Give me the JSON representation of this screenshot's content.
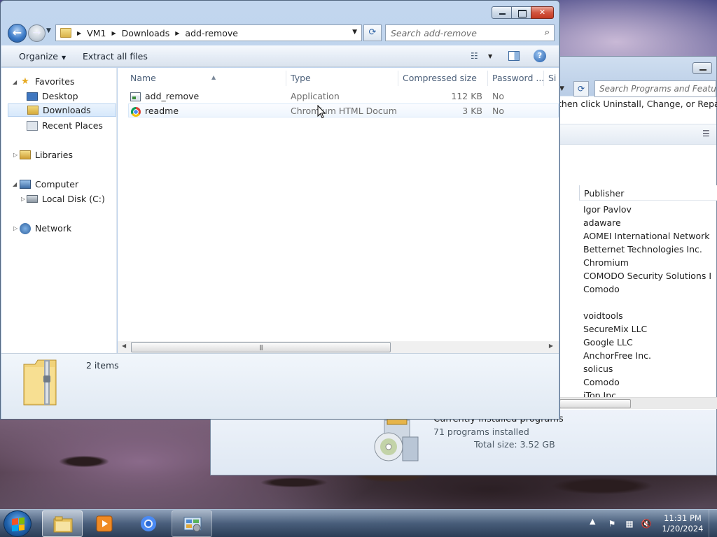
{
  "bg_window": {
    "search_placeholder": "Search Programs and Features",
    "description": "then click Uninstall, Change, or Repair.",
    "column_publisher": "Publisher",
    "publishers": [
      "Igor Pavlov",
      "adaware",
      "AOMEI International Network Li...",
      "Betternet Technologies Inc.",
      "Chromium",
      "COMODO Security Solutions Inc.",
      "Comodo",
      "",
      "voidtools",
      "SecureMix LLC",
      "Google LLC",
      "AnchorFree Inc.",
      "solicus",
      "Comodo",
      "iTop Inc."
    ],
    "details_title": "Currently installed programs",
    "details_count": "71 programs installed",
    "details_size": "Total size: 3.52 GB"
  },
  "explorer": {
    "breadcrumb": [
      "VM1",
      "Downloads",
      "add-remove"
    ],
    "search_placeholder": "Search add-remove",
    "toolbar": {
      "organize": "Organize",
      "extract": "Extract all files"
    },
    "nav": {
      "favorites": "Favorites",
      "desktop": "Desktop",
      "downloads": "Downloads",
      "recent": "Recent Places",
      "libraries": "Libraries",
      "computer": "Computer",
      "local_disk": "Local Disk (C:)",
      "network": "Network"
    },
    "columns": {
      "name": "Name",
      "type": "Type",
      "compressed": "Compressed size",
      "password": "Password ...",
      "size": "Si"
    },
    "files": [
      {
        "name": "add_remove",
        "type": "Application",
        "compressed": "112 KB",
        "password": "No",
        "icon": "application-icon"
      },
      {
        "name": "readme",
        "type": "Chromium HTML Docum...",
        "compressed": "3 KB",
        "password": "No",
        "icon": "chromium-document-icon"
      }
    ],
    "status": {
      "items": "2 items"
    }
  },
  "taskbar": {
    "time": "11:31 PM",
    "date": "1/20/2024"
  },
  "colors": {
    "accent": "#3d7cc9",
    "close": "#c23a22"
  }
}
